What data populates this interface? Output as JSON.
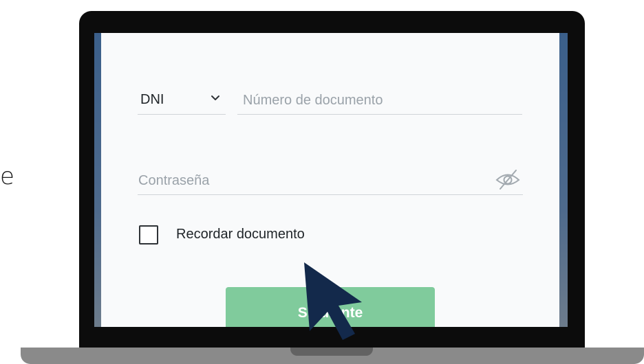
{
  "side_text": {
    "letter": "e"
  },
  "login_form": {
    "document_type": {
      "selected": "DNI",
      "icon": "chevron-down-icon"
    },
    "document_number": {
      "value": "",
      "placeholder": "Número de documento"
    },
    "password": {
      "value": "",
      "placeholder": "Contraseña",
      "toggle_icon": "eye-off-icon"
    },
    "remember_document": {
      "label": "Recordar documento",
      "checked": false
    },
    "submit": {
      "label": "Siguiente",
      "color": "#80cb9c"
    }
  },
  "overlay": {
    "cursor_icon": "mouse-pointer-icon",
    "cursor_color": "#13294b"
  },
  "colors": {
    "screen_bezel": "#0c0c0c",
    "laptop_base": "#8a8a8a",
    "screen_background": "#3b5f8a",
    "card_background": "#f9fafb"
  }
}
